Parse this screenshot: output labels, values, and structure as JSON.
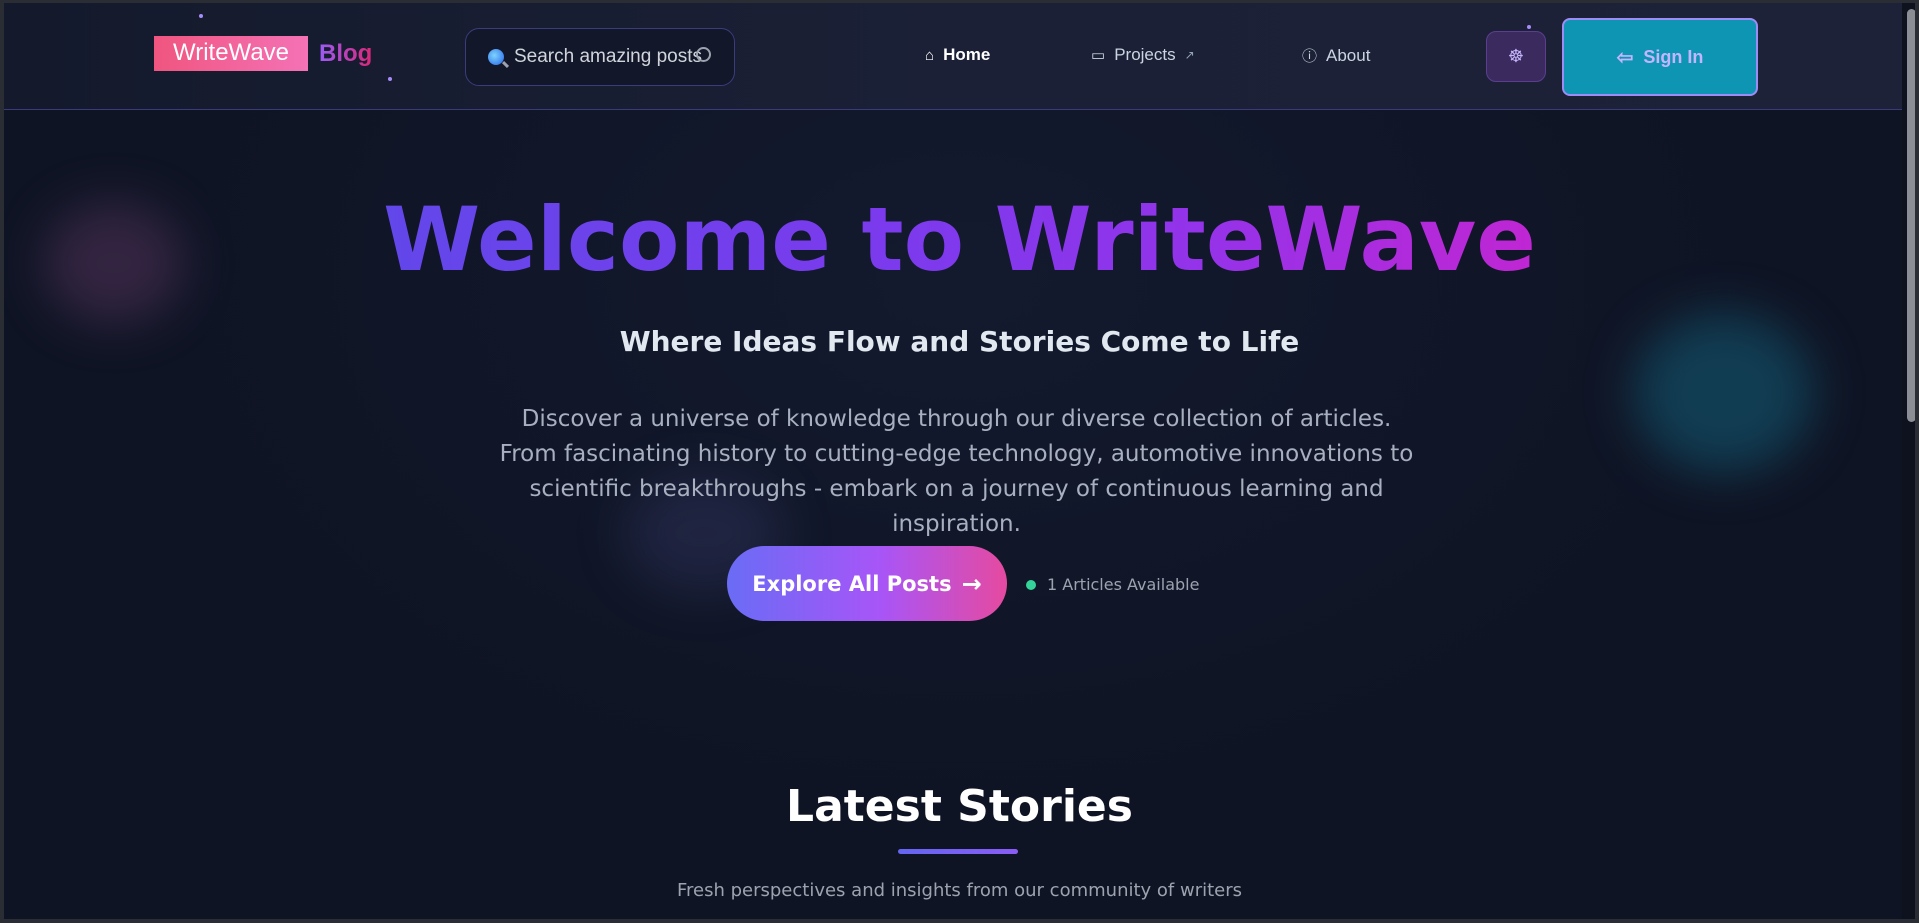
{
  "header": {
    "logo_main": "WriteWave",
    "logo_sub": "Blog",
    "search_placeholder": "Search amazing posts",
    "nav": {
      "home": "Home",
      "projects": "Projects",
      "about": "About"
    },
    "sign_in": "Sign In"
  },
  "hero": {
    "title": "Welcome to WriteWave",
    "subtitle": "Where Ideas Flow and Stories Come to Life",
    "description": "Discover a universe of knowledge through our diverse collection of articles. From fascinating history to cutting-edge technology, automotive innovations to scientific breakthroughs - embark on a journey of continuous learning and inspiration.",
    "cta": "Explore All Posts",
    "cta_arrow": "→",
    "available": "1 Articles Available"
  },
  "latest": {
    "title": "Latest Stories",
    "subtitle": "Fresh perspectives and insights from our community of writers"
  },
  "icons": {
    "home": "⌂",
    "projects": "▭",
    "external": "↗",
    "about": "ⓘ",
    "theme": "☸",
    "signin": "⇦"
  },
  "colors": {
    "background": "#0f1424",
    "accent_purple": "#7c3aed",
    "accent_pink": "#db2777",
    "signin_bg": "#0e95b4",
    "status_green": "#34d399"
  }
}
